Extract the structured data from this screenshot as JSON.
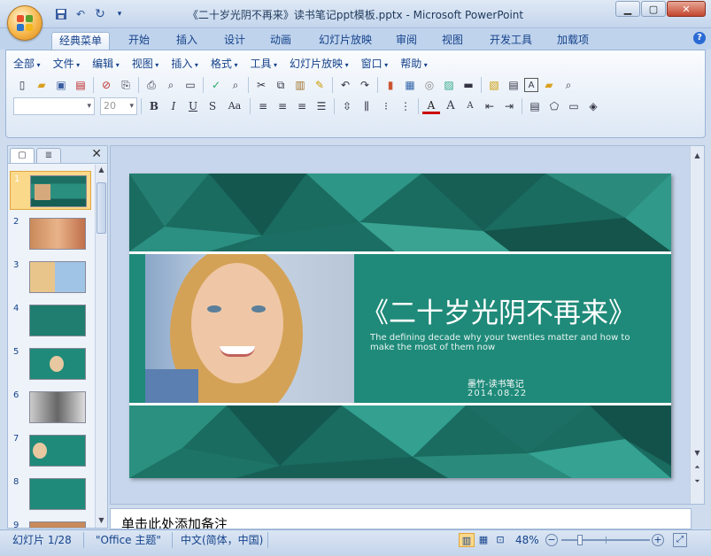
{
  "window": {
    "title": "《二十岁光阴不再来》读书笔记ppt模板.pptx - Microsoft PowerPoint"
  },
  "ribbon_tabs": [
    "经典菜单",
    "开始",
    "插入",
    "设计",
    "动画",
    "幻灯片放映",
    "审阅",
    "视图",
    "开发工具",
    "加载项"
  ],
  "menus": [
    "全部",
    "文件",
    "编辑",
    "视图",
    "插入",
    "格式",
    "工具",
    "幻灯片放映",
    "窗口",
    "帮助"
  ],
  "font": {
    "name": "",
    "size": "20"
  },
  "slides": [
    {
      "num": "1"
    },
    {
      "num": "2"
    },
    {
      "num": "3"
    },
    {
      "num": "4"
    },
    {
      "num": "5"
    },
    {
      "num": "6"
    },
    {
      "num": "7"
    },
    {
      "num": "8"
    },
    {
      "num": "9"
    }
  ],
  "slide_content": {
    "title": "《二十岁光阴不再来》",
    "subtitle": "The defining decade why your twenties matter and how to make the most of them now",
    "author": "墨竹-读书笔记",
    "date": "2014.08.22"
  },
  "notes": {
    "placeholder": "单击此处添加备注"
  },
  "status": {
    "slide": "幻灯片 1/28",
    "theme": "\"Office 主题\"",
    "language": "中文(简体，中国)",
    "zoom": "48%"
  },
  "colors": {
    "accent": "#1f8a79",
    "selected": "#fbd98a"
  }
}
